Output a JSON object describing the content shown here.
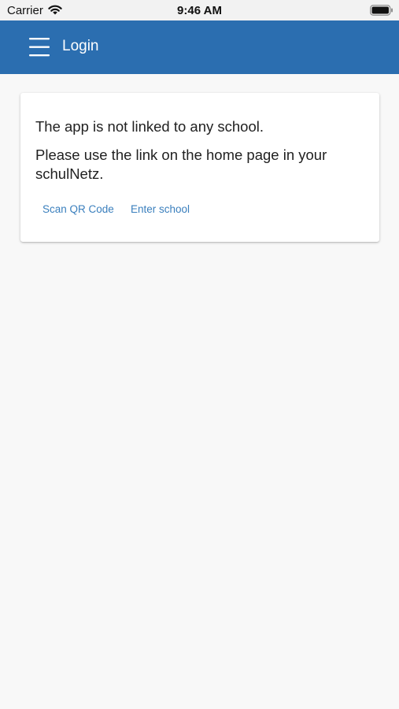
{
  "status_bar": {
    "carrier": "Carrier",
    "time": "9:46 AM",
    "icons": [
      "wifi-icon",
      "battery-icon"
    ]
  },
  "app_bar": {
    "title": "Login",
    "menu_icon": "hamburger-menu-icon",
    "color": "#2b6eb0"
  },
  "card": {
    "message_line1": "The app is not linked to any school.",
    "message_line2": "Please use the link on the home page in your schulNetz.",
    "actions": {
      "scan_qr": "Scan QR Code",
      "enter_school": "Enter school"
    },
    "link_color": "#3a7fbd"
  }
}
